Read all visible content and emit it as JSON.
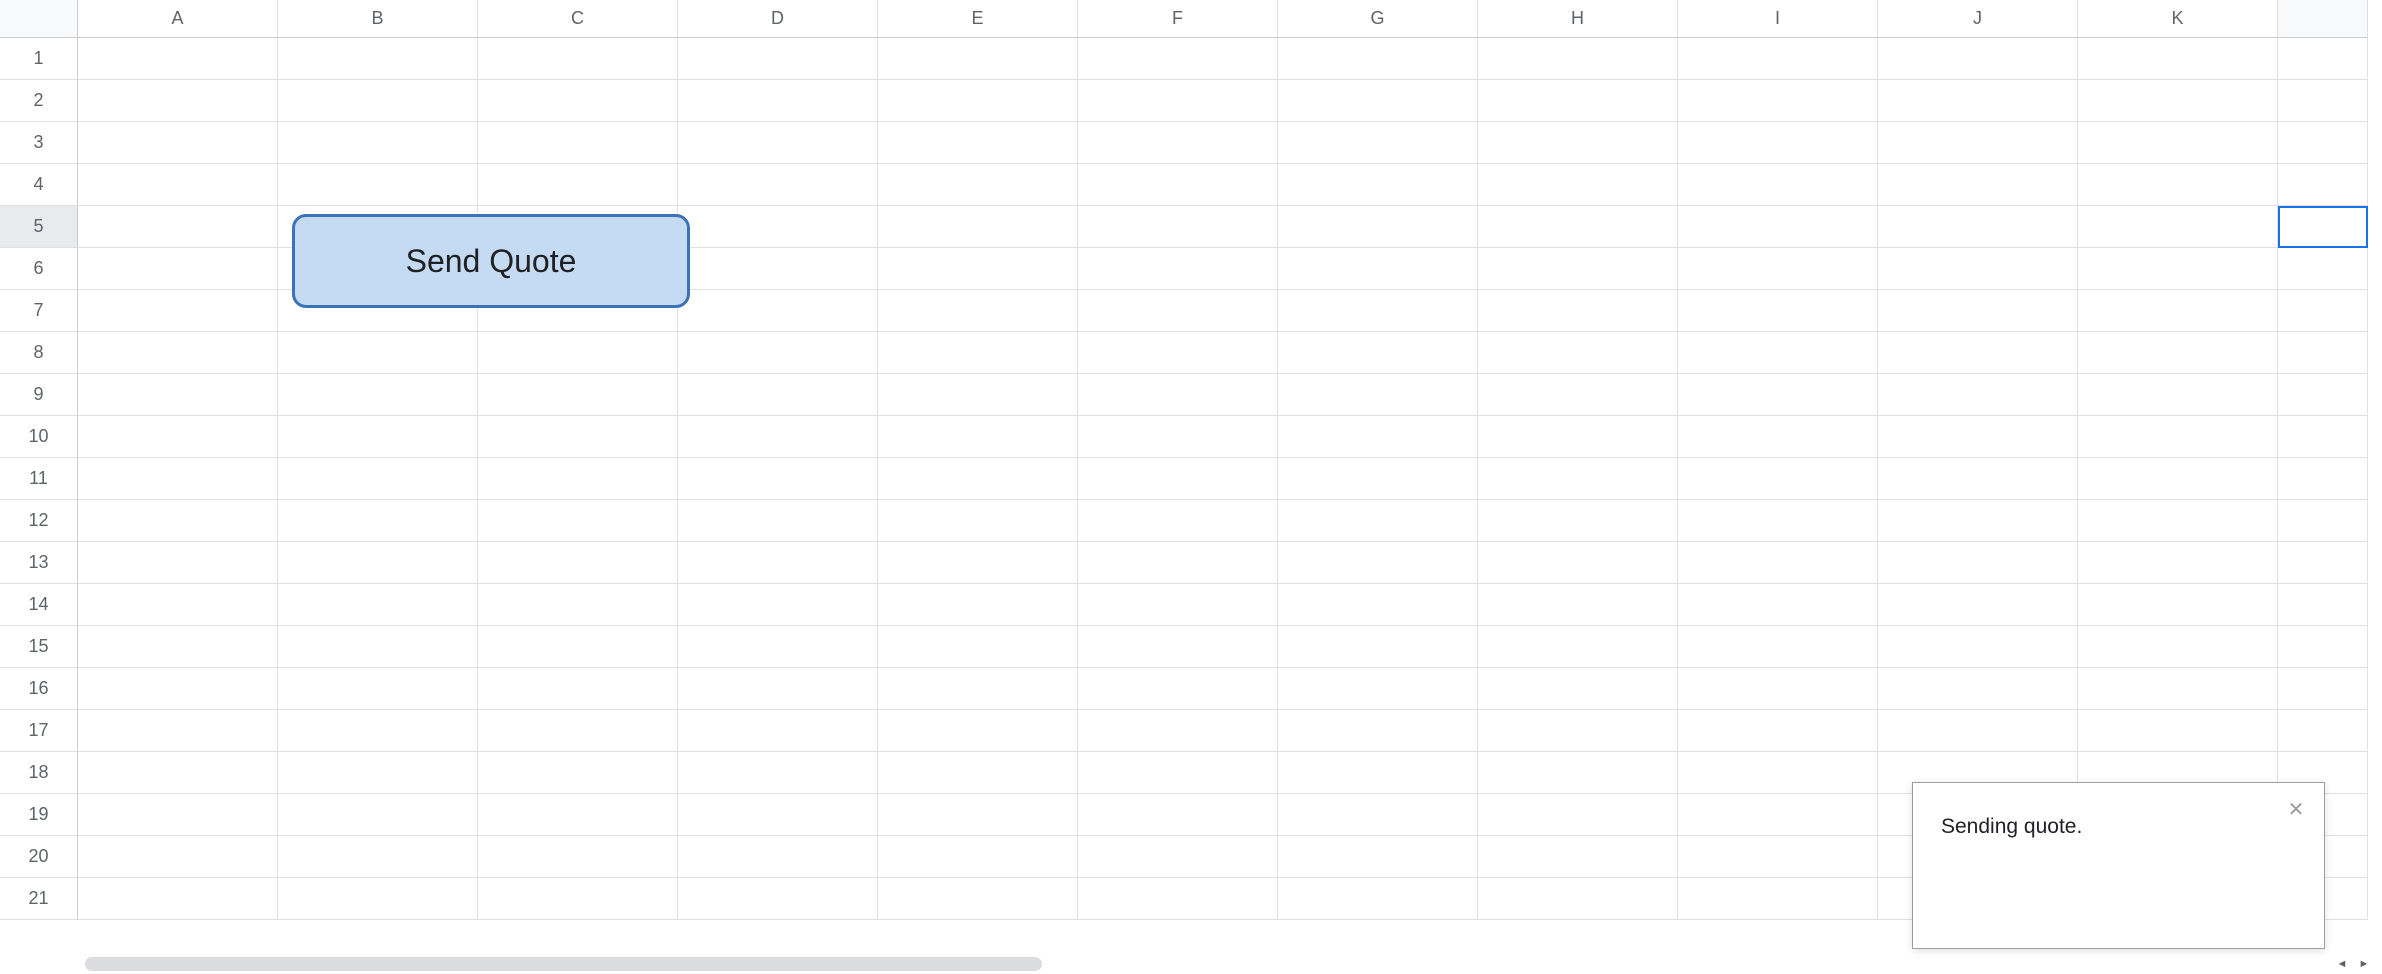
{
  "columns": [
    "A",
    "B",
    "C",
    "D",
    "E",
    "F",
    "G",
    "H",
    "I",
    "J",
    "K"
  ],
  "rows": [
    "1",
    "2",
    "3",
    "4",
    "5",
    "6",
    "7",
    "8",
    "9",
    "10",
    "11",
    "12",
    "13",
    "14",
    "15",
    "16",
    "17",
    "18",
    "19",
    "20",
    "21"
  ],
  "selected_row": "5",
  "button": {
    "send_quote_label": "Send Quote"
  },
  "toast": {
    "message": "Sending quote."
  }
}
